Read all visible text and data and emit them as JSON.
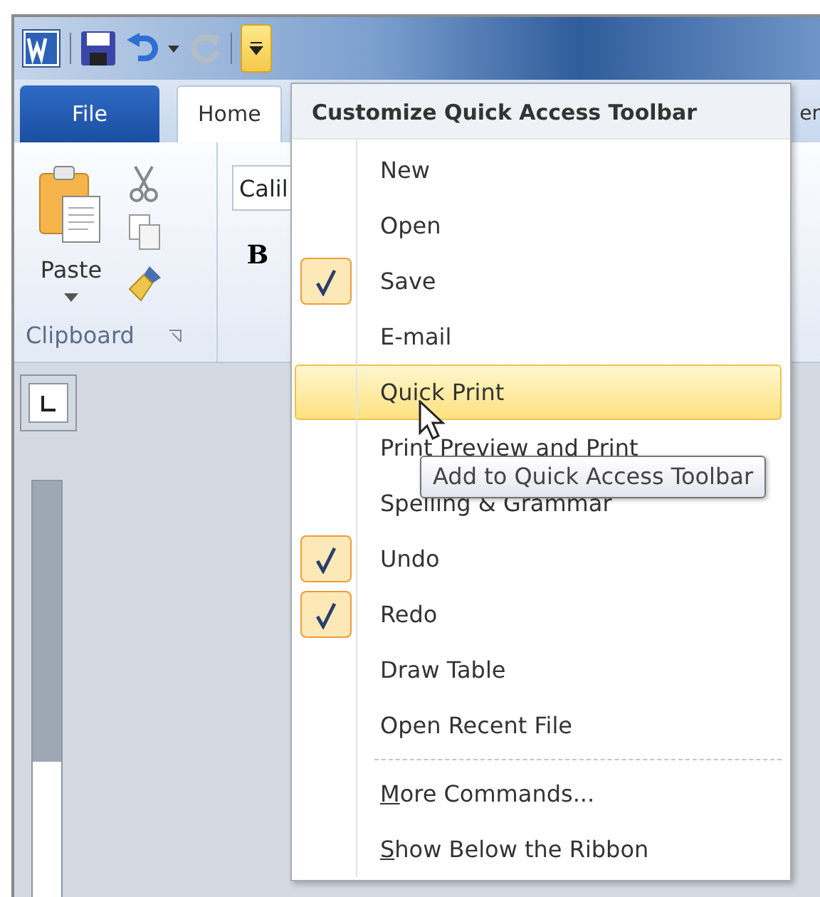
{
  "quick_access_toolbar": [
    {
      "kind": "app"
    },
    {
      "kind": "save"
    },
    {
      "kind": "undo"
    },
    {
      "kind": "redo",
      "disabled": true
    },
    {
      "kind": "customize",
      "expanded": true
    }
  ],
  "tabs": [
    {
      "label": "File",
      "kind": "file",
      "selected": false
    },
    {
      "label": "Home",
      "kind": "tab",
      "selected": true
    },
    {
      "label": "er",
      "kind": "tab",
      "selected": false
    }
  ],
  "ribbon": {
    "paste_label": "Paste",
    "group_label": "Clipboard",
    "font_box": {
      "value": "Calil"
    },
    "bold_label": "B"
  },
  "menu": {
    "title": "Customize Quick Access Toolbar",
    "items": [
      {
        "label": "New",
        "checked": false,
        "selected": false
      },
      {
        "label": "Open",
        "checked": false,
        "selected": false
      },
      {
        "label": "Save",
        "checked": true,
        "selected": false
      },
      {
        "label": "E-mail",
        "checked": false,
        "selected": false
      },
      {
        "label": "Quick Print",
        "checked": false,
        "selected": true
      },
      {
        "label": "Print Preview and Print",
        "checked": false,
        "selected": false
      },
      {
        "label": "Spelling & Grammar",
        "checked": false,
        "selected": false
      },
      {
        "label": "Undo",
        "checked": true,
        "selected": false
      },
      {
        "label": "Redo",
        "checked": true,
        "selected": false
      },
      {
        "label": "Draw Table",
        "checked": false,
        "selected": false
      },
      {
        "label": "Open Recent File",
        "checked": false,
        "selected": false
      }
    ],
    "footer_items": [
      {
        "label": "More Commands...",
        "underline_first": true
      },
      {
        "label": "Show Below the Ribbon",
        "underline_first": true
      }
    ]
  },
  "tooltip": {
    "text": "Add to Quick Access Toolbar"
  }
}
